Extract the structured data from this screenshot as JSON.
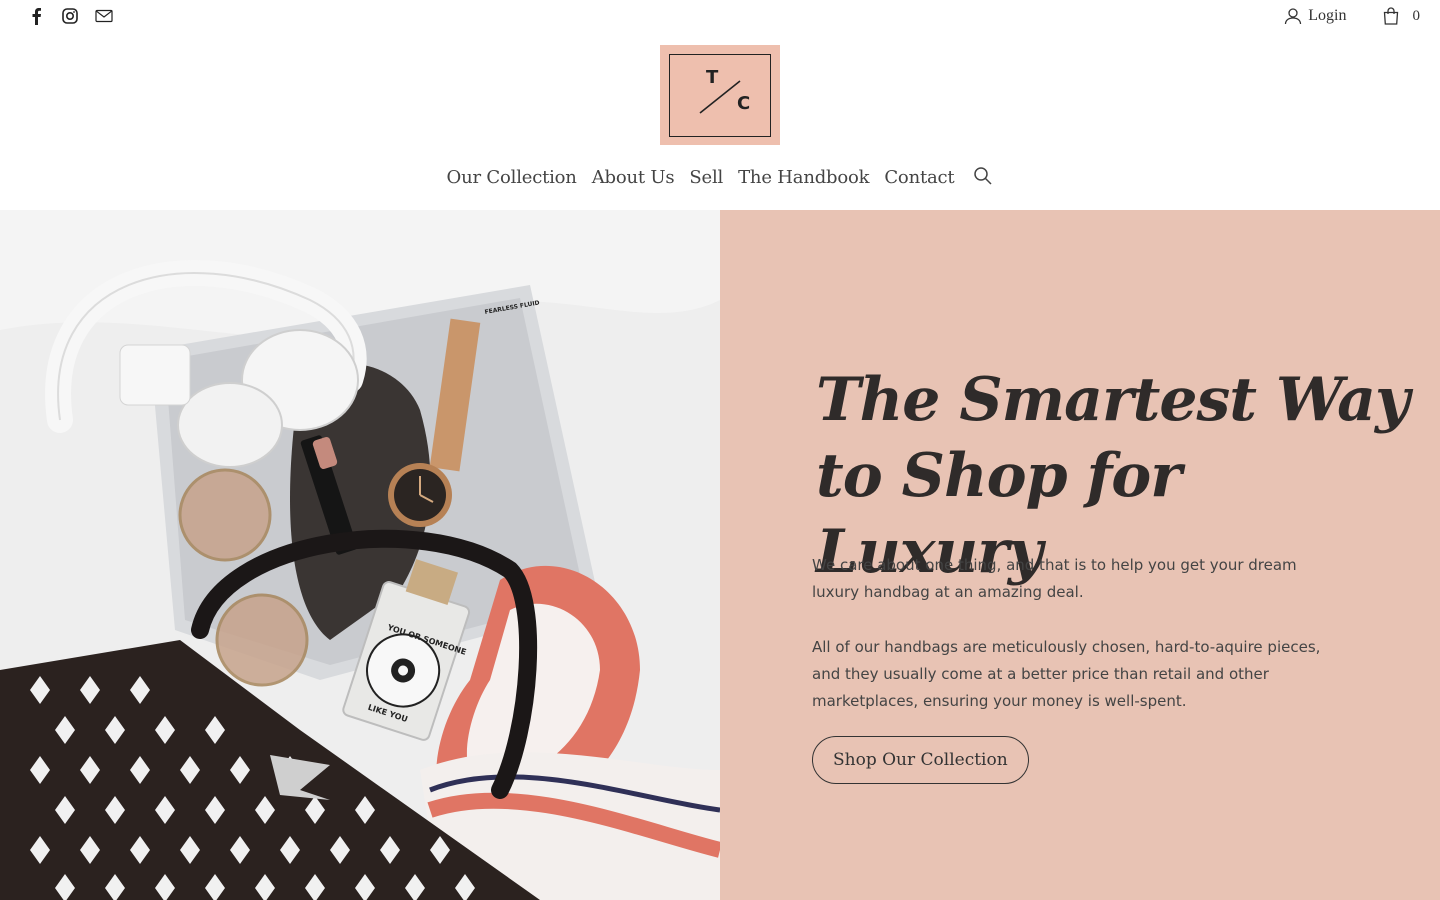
{
  "topbar": {
    "social_icons": [
      "facebook-icon",
      "instagram-icon",
      "email-icon"
    ],
    "login_label": "Login",
    "cart_count": "0"
  },
  "logo": {
    "letter_top": "T",
    "letter_bottom": "C"
  },
  "nav": {
    "items": [
      "Our Collection",
      "About Us",
      "Sell",
      "The Handbook",
      "Contact"
    ],
    "search_icon": "search-icon"
  },
  "hero": {
    "headline_line1": "The Smartest Way",
    "headline_line2": "to Shop for Luxury",
    "paragraph1": "We care about one thing, and that is to help you get your dream luxury handbag at an amazing deal.",
    "paragraph2": "All of our handbags are meticulously chosen, hard-to-aquire pieces, and they usually come at a better price than retail and other marketplaces, ensuring your money is well-spent.",
    "cta_label": "Shop Our Collection",
    "image_text": {
      "magazine_heading": "FEARLESS FLUID",
      "perfume_label_top": "YOU OR SOMEONE",
      "perfume_label_bottom": "LIKE YOU"
    }
  },
  "colors": {
    "accent_pink": "#e8c3b4",
    "logo_pink": "#eebfae",
    "text_dark": "#2f2b2a"
  }
}
